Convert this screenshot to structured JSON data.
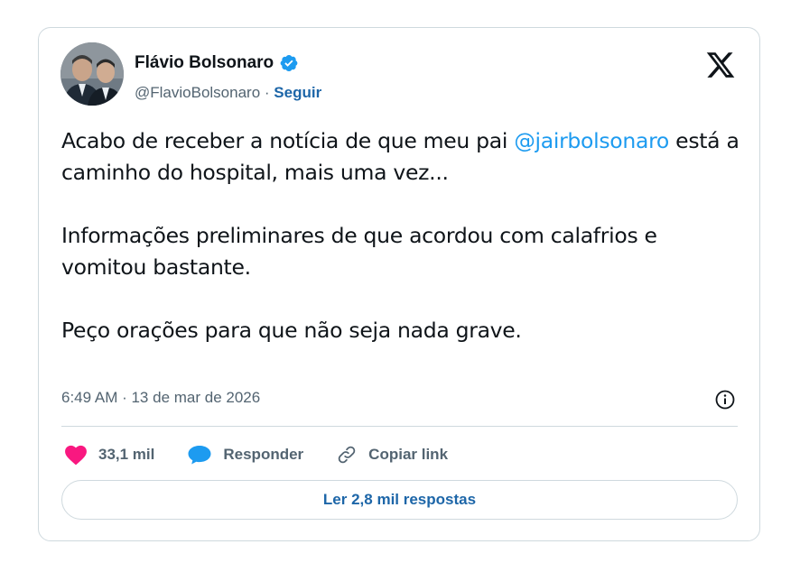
{
  "author": {
    "display_name": "Flávio Bolsonaro",
    "handle": "@FlavioBolsonaro",
    "separator": "·",
    "follow_label": "Seguir",
    "verified": true
  },
  "tweet": {
    "line1_prefix": "Acabo de receber a notícia de que meu pai",
    "mention": "@jairbolsonaro",
    "line1_suffix": "está a caminho do hospital, mais uma vez...",
    "paragraph2": "Informações preliminares de que acordou com calafrios e vomitou bastante.",
    "paragraph3": "Peço orações para que não seja nada grave.",
    "timestamp": "6:49 AM · 13 de mar de 2026"
  },
  "actions": {
    "likes": "33,1 mil",
    "reply_label": "Responder",
    "copy_link_label": "Copiar link"
  },
  "read_replies_label": "Ler 2,8 mil respostas",
  "icons": {
    "platform_logo": "x-logo-icon",
    "verified": "verified-badge-icon",
    "info": "info-icon",
    "like": "heart-icon",
    "reply": "speech-bubble-icon",
    "copy_link": "link-icon"
  },
  "colors": {
    "accent_blue": "#1d9bf0",
    "link_blue": "#1d66a8",
    "heart_pink": "#f91880",
    "text_primary": "#0f1419",
    "text_secondary": "#536471",
    "border": "#cfd9de"
  }
}
